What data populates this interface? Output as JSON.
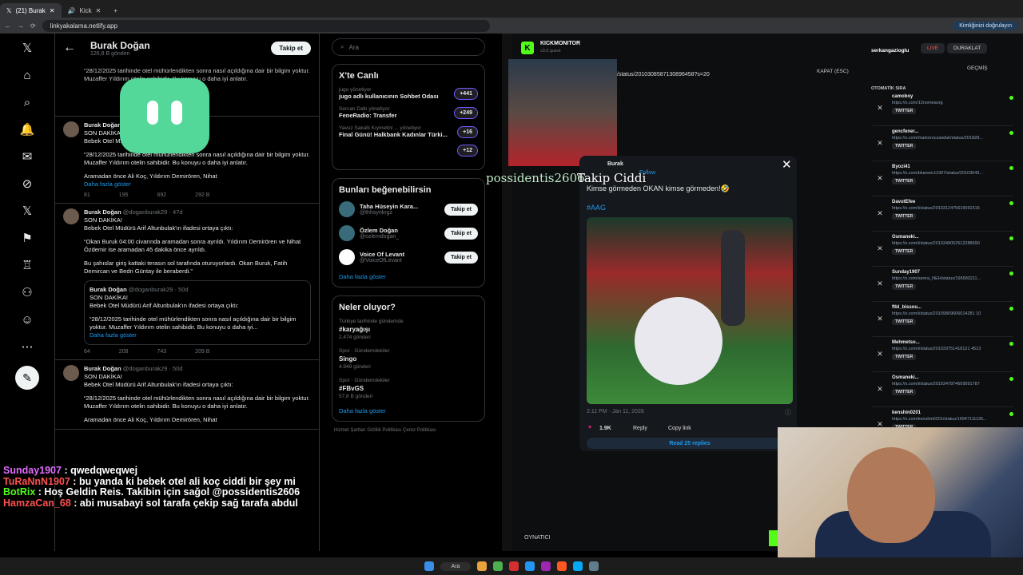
{
  "browser": {
    "tabs": [
      {
        "label": "(21) Burak",
        "active": true
      },
      {
        "label": "Kick",
        "active": false
      }
    ],
    "url": "linkyakalama.netlify.app",
    "verify_label": "Kimliğinizi doğrulayın"
  },
  "profile": {
    "name": "Burak Doğan",
    "posts_count": "126,8 B gönderi",
    "follow_label": "Takip et"
  },
  "posts": [
    {
      "name": "Burak Doğan",
      "handle": "@doganburak29 · 47d",
      "lines": [
        "SON DAKİKA!",
        "Bebek Otel Müdürü Arif Altunbulak'ın ifadesi ortaya çıktı:"
      ],
      "p2": "“Okan Buruk 04:00 civarında aramadan sonra ayrıldı. Yıldırım Demirören ve Nihat Özdemir ise aramadan 45 dakika önce ayrıldı.",
      "p3": "Bu şahıslar giriş kattaki terasın sol tarafında oturuyorlardı. Okan Buruk, Fatih Demircan ve Bedri Güntay ile beraberdi.”",
      "quote": {
        "name": "Burak Doğan",
        "handle": "@doganburak29 · 50d",
        "l1": "SON DAKİKA!",
        "l2": "Bebek Otel Müdürü Arif Altunbulak'ın ifadesi ortaya çıktı:",
        "l3": "“28/12/2025 tarihinde otel mühürlendikten sonra nasıl açıldığına dair bir bilgim yoktur. Muzaffer Yıldırım otelin sahibidir. Bu konuyu o daha iyi...",
        "more": "Daha fazla göster"
      },
      "stats": {
        "replies": "64",
        "reposts": "208",
        "likes": "743",
        "views": "209 B"
      }
    },
    {
      "name": "Burak Doğan",
      "handle": "@doganburak29 · 50d",
      "lines": [
        "SON DAKİKA!",
        "Bebek Otel Müdürü Arif Altunbulak'ın ifadesi ortaya çıktı:"
      ],
      "p2": "“28/12/2025 tarihinde otel mühürlendikten sonra nasıl açıldığına dair bir bilgim yoktur. Muzaffer Yıldırım otelin sahibidir. Bu konuyu o daha iyi anlatır.",
      "p3": "Aramadan önce Ali Koç, Yıldırım Demirören, Nihat"
    }
  ],
  "top_post": {
    "name": "Burak Doğan",
    "l1": "SON DAKİKA!",
    "l2": "Bebek Otel M... ifadesi ortaya çıktı:",
    "p2": "“28/12/2025 tarihinde otel mühürlendikten sonra nasıl açıldığına dair bir bilgim yoktur. Muzaffer Yıldırım otelin sahibidir. Bu konuyu o daha iyi anlatır.",
    "p3": "Aramadan önce Ali Koç, Yıldırım Demirören, Nihat",
    "more": "Daha fazla göster",
    "stats": {
      "replies": "81",
      "reposts": "195",
      "likes": "692",
      "views": "292 B"
    },
    "top_views": "209 B"
  },
  "right": {
    "search_placeholder": "Ara",
    "live_title": "X'te Canlı",
    "lives": [
      {
        "host": "jugo yönetiyor",
        "title": "jugo adlı kullanıcının Sohbet Odası",
        "count": "+441"
      },
      {
        "host": "Sercan Dallı yönetiyor",
        "title": "FeneRadio: Transfer",
        "count": "+249"
      },
      {
        "host": "Yavuz Sakallı Kıymetini ... yönetiyor",
        "title": "Final Günü! Halkbank Kadınlar Türki...",
        "count": "+16"
      },
      {
        "host": "",
        "title": "",
        "count": "+12"
      }
    ],
    "suggest_title": "Bunları beğenebilirsin",
    "suggestions": [
      {
        "name": "Taha Hüseyin Kara...",
        "handle": "@thhsynkrgz",
        "btn": "Takip et"
      },
      {
        "name": "Özlem Doğan",
        "handle": "@ozlemdogan_",
        "btn": "Takip et"
      },
      {
        "name": "Voice Of Levant",
        "handle": "@VoiceOfLevant",
        "btn": "Takip et"
      }
    ],
    "show_more": "Daha fazla göster",
    "trends_title": "Neler oluyor?",
    "trends": [
      {
        "cat": "Türkiye tarihinde gündemde",
        "tag": "#karyağışı",
        "count": "2.474 gönderi"
      },
      {
        "cat": "Spor · Gündemdekiler",
        "tag": "Singo",
        "count": "4.949 gönderi"
      },
      {
        "cat": "Spor · Gündemdekiler",
        "tag": "#FBvGS",
        "count": "57,8 B gönderi"
      }
    ],
    "trends_more": "Daha fazla göster",
    "footer": "Hizmet Şartları   Gizlilik Politikası   Çerez Politikası"
  },
  "kick": {
    "brand": "KICKMONITOR",
    "version": "v3.0 guest",
    "channel": "serkangazioglu",
    "live_label": "LIVE",
    "stop_label": "DURAKLAT",
    "history_label": "GEÇMİŞ",
    "close_label": "KAPAT (ESC)",
    "status_url": "/status/2010308587130896458?s=20",
    "auto_label": "OTOMATİK SIRA",
    "overlay_user": "possidentis2606",
    "overlay_msg": "Takip Ciddi",
    "player_label": "OYNATICI",
    "items": [
      {
        "user": "camoboy",
        "link": "https://x.com/12nomeaorg",
        "tw": "TWITTER"
      },
      {
        "user": "gencfener...",
        "link": "https://x.com/markorsczaoduk/status/201828...",
        "tw": "TWITTER"
      },
      {
        "user": "Byozi41",
        "link": "https://x.com/bluesmr11907/status/20103543...",
        "tw": "TWITTER"
      },
      {
        "user": "DavutEfee",
        "link": "https://x.com/i/status/2010312475616591515",
        "tw": "TWITTER"
      },
      {
        "user": "Osmaneki...",
        "link": "https://x.com/i/status/2010349052512288690",
        "tw": "TWITTER"
      },
      {
        "user": "Sunday1907",
        "link": "https://x.com/serrra_NEH/status/196583211...",
        "tw": "TWITTER"
      },
      {
        "user": "ftbl_bissou...",
        "link": "https://x.com/i/status/20109809606014281 10",
        "tw": "TWITTER"
      },
      {
        "user": "Mehmetso...",
        "link": "https://x.com/i/status/201033751418121 4513",
        "tw": "TWITTER"
      },
      {
        "user": "Osmaneki...",
        "link": "https://x.com/i/status/2010347874609991787",
        "tw": "TWITTER"
      },
      {
        "user": "kenshin0201",
        "link": "https://x.com/kenshin0201/status/19947111135...",
        "tw": "TWITTER"
      }
    ]
  },
  "popup": {
    "author": "Burak",
    "follow": "Follow",
    "text": "Kimse görmeden OKAN kimse görmeden!🤣",
    "tag": "#AAG",
    "time": "2:11 PM · Jan 11, 2026",
    "likes": "1.9K",
    "reply": "Reply",
    "copy": "Copy link",
    "read": "Read 25 replies"
  },
  "chat": [
    {
      "user": "Sunday1907",
      "color": "#e06cff",
      "msg": "qwedqweqwej"
    },
    {
      "user": "TuRaNnN1907",
      "color": "#ff5050",
      "msg": "bu yanda ki bebek otel ali koç ciddi bir şey mi"
    },
    {
      "user": "BotRix",
      "color": "#53fc18",
      "msg": "Hoş Geldin Reis. Takibin için sağol @possidentis2606"
    },
    {
      "user": "HamzaCan_68",
      "color": "#ff5050",
      "msg": "abi musabayi sol tarafa çekip sağ tarafa abdul"
    }
  ],
  "colors": {
    "accent": "#1d9bf0",
    "kick_green": "#53fc18",
    "bg": "#000000"
  }
}
